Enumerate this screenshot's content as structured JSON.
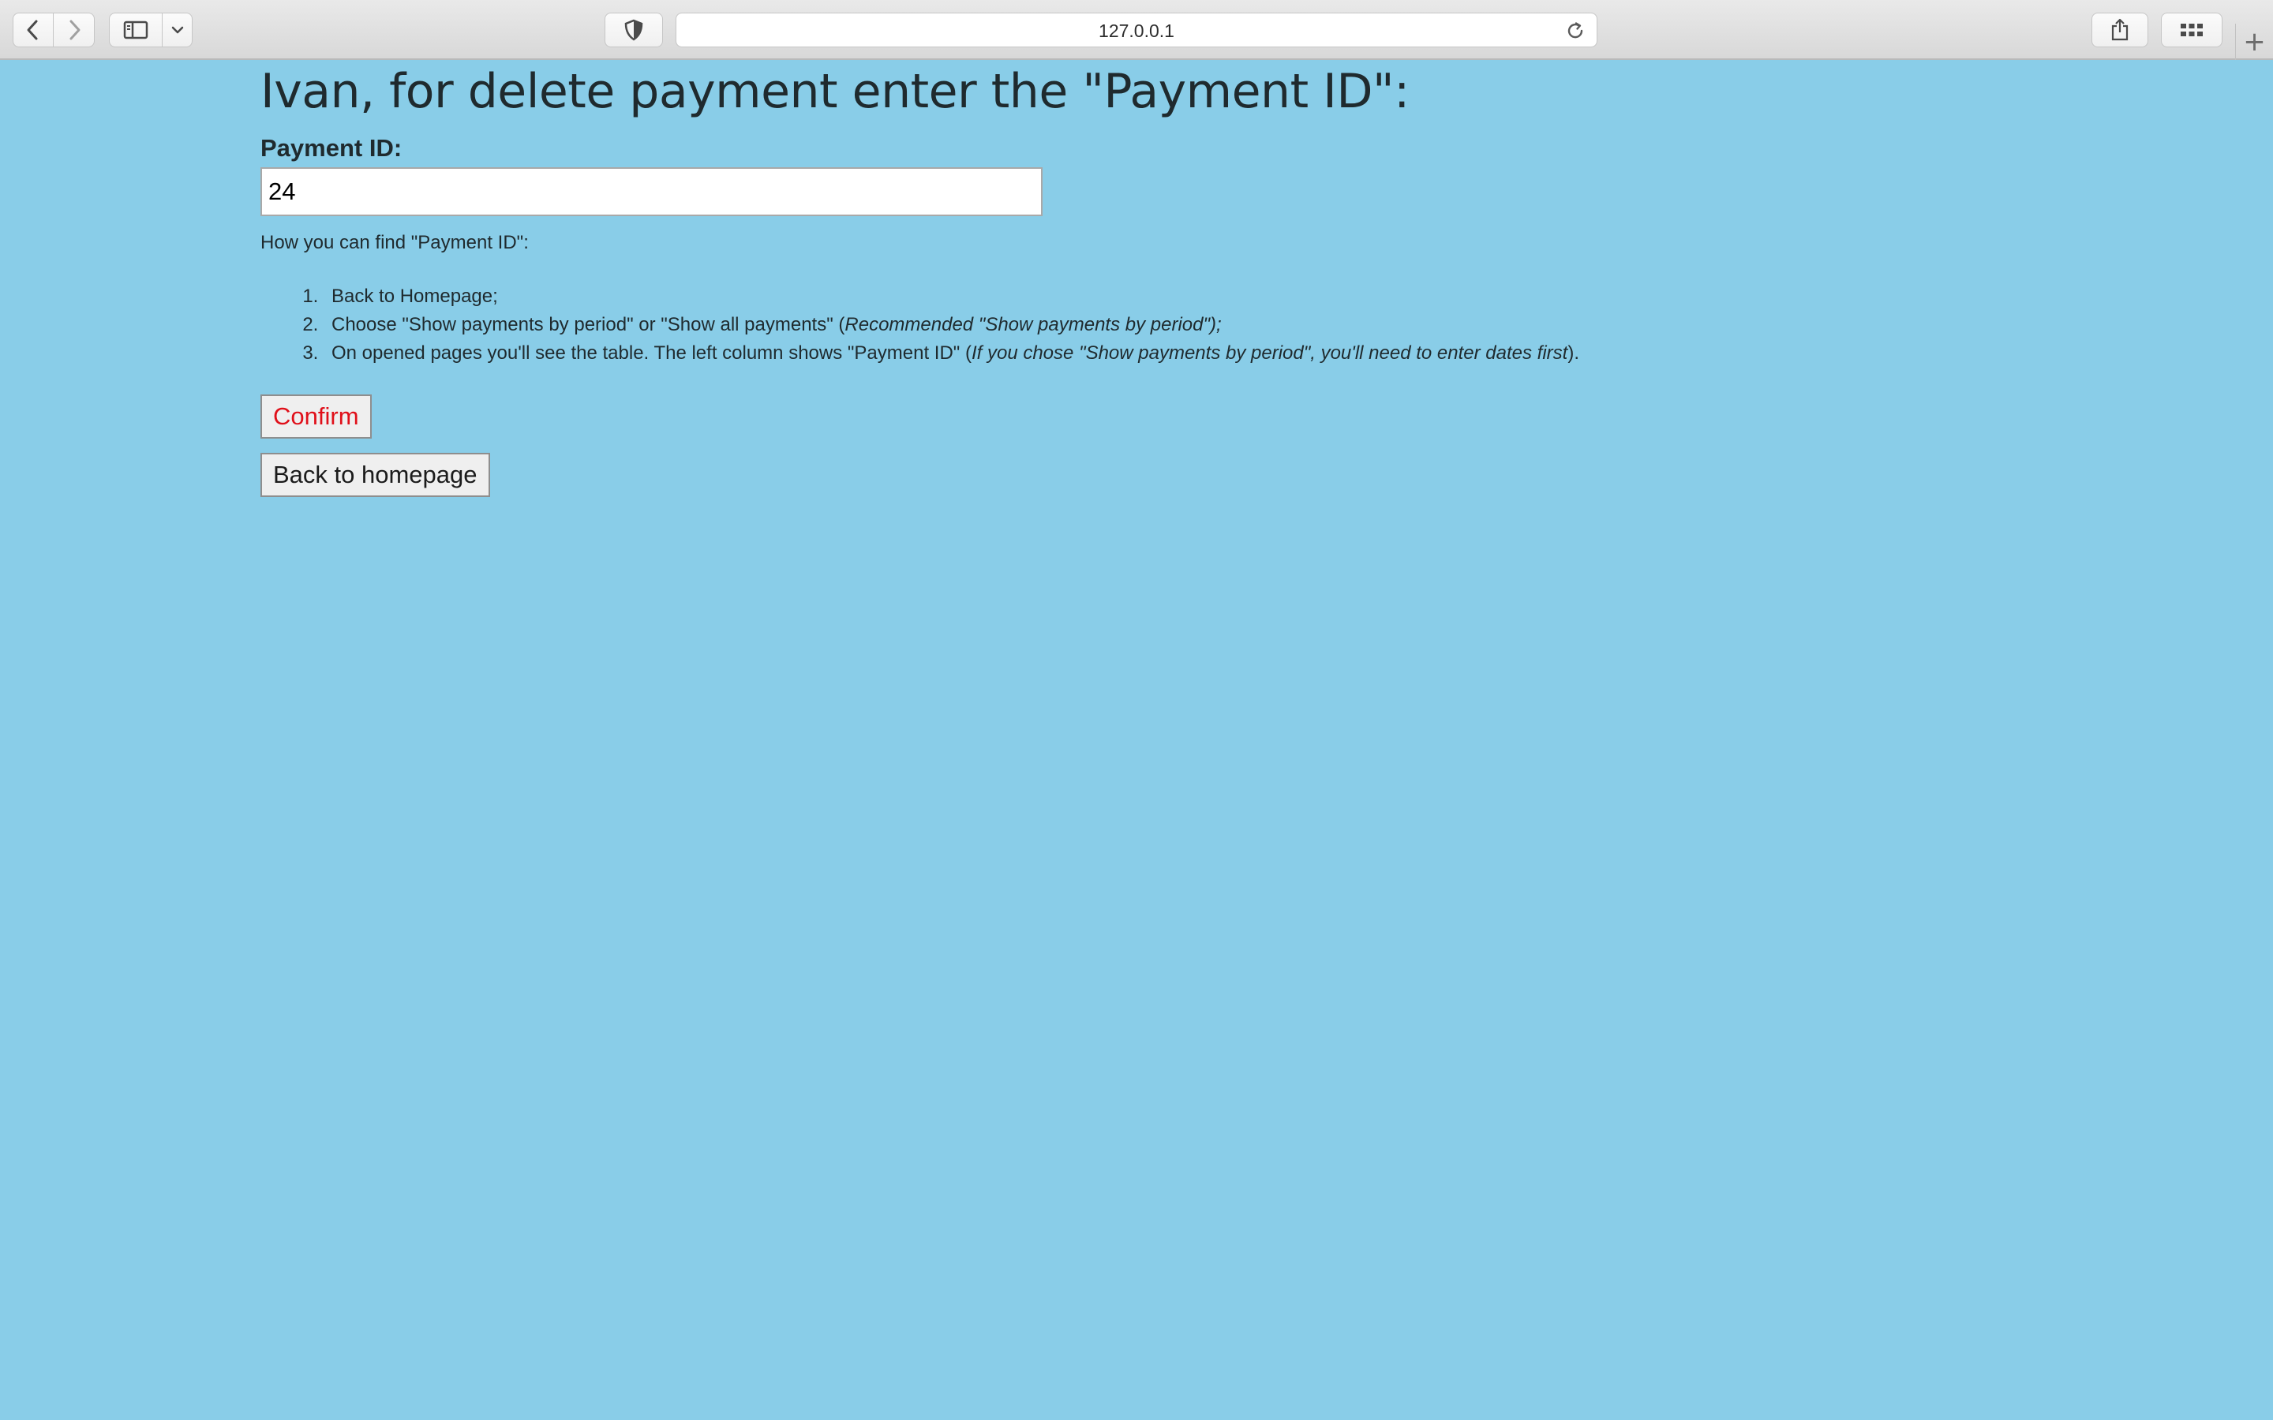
{
  "browser": {
    "url": "127.0.0.1",
    "icons": {
      "back": "chevron-left-icon",
      "forward": "chevron-right-icon",
      "sidebar": "sidebar-icon",
      "sidebar_menu": "chevron-down-icon",
      "privacy": "shield-icon",
      "reload": "reload-icon",
      "share": "share-icon",
      "tabs": "grid-icon",
      "new_tab": "plus-icon"
    }
  },
  "page": {
    "title": "Ivan, for delete payment enter the \"Payment ID\":",
    "field_label": "Payment ID:",
    "payment_id_value": "24",
    "hint": "How you can find \"Payment ID\":",
    "steps": [
      {
        "text": "Back to Homepage;",
        "note": ""
      },
      {
        "text": "Choose \"Show payments by period\" or \"Show all payments\" (",
        "note": "Recommended \"Show payments by period\"",
        "tail": ");"
      },
      {
        "text": "On opened pages you'll see the table. The left column shows \"Payment ID\" (",
        "note": "If you chose \"Show payments by period\", you'll need to enter dates first",
        "tail": ")."
      }
    ],
    "confirm_label": "Confirm",
    "back_label": "Back to homepage"
  },
  "colors": {
    "page_background": "#89cde8",
    "confirm_text": "#e0101a"
  }
}
